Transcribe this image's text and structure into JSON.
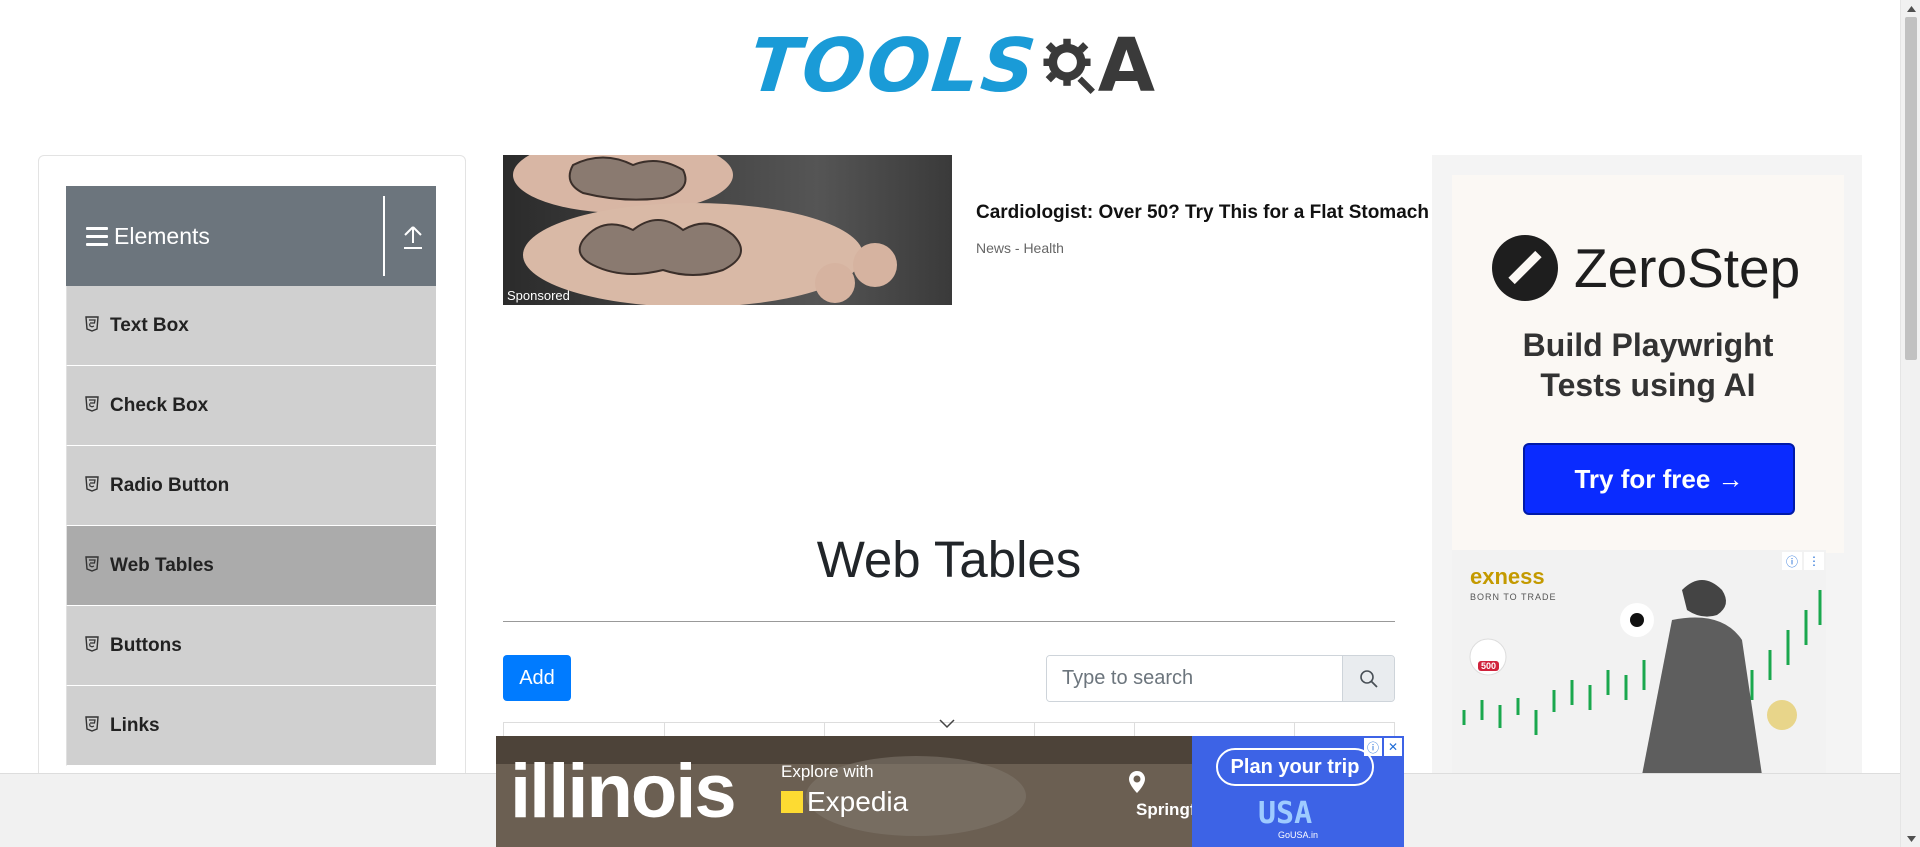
{
  "header": {
    "logo_tools": "TOOLS",
    "logo_a": "A"
  },
  "sidebar": {
    "group_title": "Elements",
    "items": [
      {
        "label": "Text Box",
        "active": false
      },
      {
        "label": "Check Box",
        "active": false
      },
      {
        "label": "Radio Button",
        "active": false
      },
      {
        "label": "Web Tables",
        "active": true
      },
      {
        "label": "Buttons",
        "active": false
      },
      {
        "label": "Links",
        "active": false
      }
    ]
  },
  "sponsored_ad": {
    "label": "Sponsored",
    "headline": "Cardiologist: Over 50? Try This for a Flat Stomach",
    "source": "News - Health"
  },
  "main": {
    "title": "Web Tables",
    "add_label": "Add",
    "search_placeholder": "Type to search"
  },
  "right_ad": {
    "brand": "ZeroStep",
    "headline_line1": "Build Playwright",
    "headline_line2": "Tests using AI",
    "cta": "Try for free →",
    "exness_brand": "exness",
    "exness_tagline": "BORN TO TRADE",
    "exness_badge": "500"
  },
  "bottom_ad": {
    "illinois": "illinois",
    "explore": "Explore with",
    "expedia": "Expedia",
    "springfield": "Springfield",
    "plan": "Plan your trip",
    "usa": "USA",
    "gousa": "GoUSA.in"
  },
  "colors": {
    "brand_blue": "#1a9bd7",
    "sidebar_header": "#6c757d",
    "menu_item": "#d0d0d0",
    "menu_item_active": "#ababab",
    "primary_button": "#007bff",
    "zerostep_cta": "#0a2bff"
  },
  "icons": {
    "menu": "hamburger-icon",
    "collapse": "upload-arrow-icon",
    "menu_item": "html5-shield-icon",
    "search": "search-icon",
    "sort": "chevron-down-icon"
  }
}
